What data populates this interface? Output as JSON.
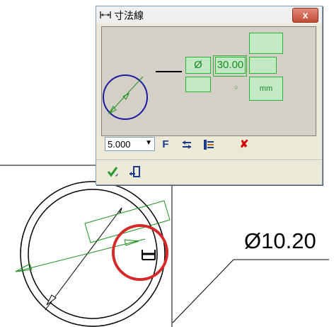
{
  "drawing": {
    "dimension_text": "Ø10.20"
  },
  "dialog": {
    "title": "寸法線",
    "close_label": "x",
    "preview": {
      "diameter_symbol": "Ø",
      "value_text": "30.00",
      "unit_text": "mm",
      "center_mark": "○"
    },
    "toolbar": {
      "scale_value": "5.000",
      "dropdown_arrow": "▼",
      "font_icon": "F",
      "swap_icon": "swap-arrows-icon",
      "properties_icon": "properties-icon",
      "delete_icon": "✘"
    },
    "bottom": {
      "ok_icon": "checkmark-icon",
      "cancel_icon": "exit-door-icon"
    }
  },
  "colors": {
    "accent_green": "#2cb336",
    "highlight_red": "#d62a2a",
    "preview_circle": "#1a1aa0"
  }
}
